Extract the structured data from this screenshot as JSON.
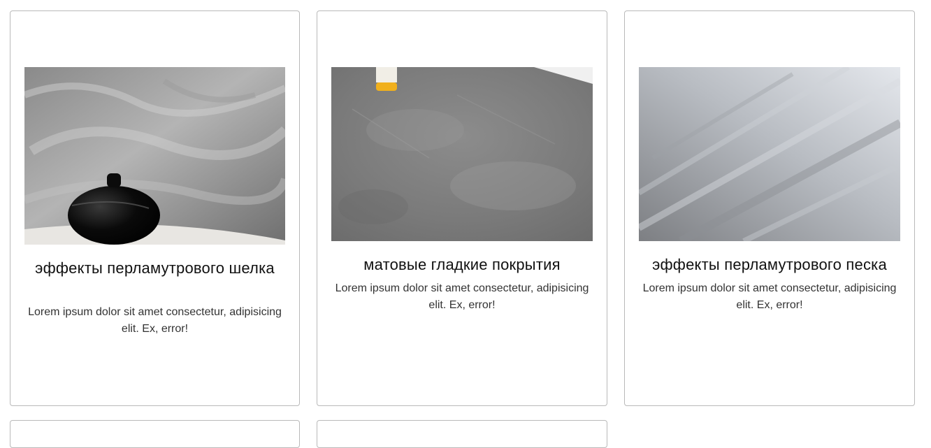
{
  "cards": [
    {
      "title": "эффекты перламутрового шелка",
      "text": "Lorem ipsum dolor sit amet consectetur, adipisicing elit. Ex, error!",
      "image": "pearl-silk-wall-with-black-vase"
    },
    {
      "title": "матовые гладкие покрытия",
      "text": "Lorem ipsum dolor sit amet consectetur, adipisicing elit. Ex, error!",
      "image": "matte-concrete-wall"
    },
    {
      "title": "эффекты перламутрового песка",
      "text": "Lorem ipsum dolor sit amet consectetur, adipisicing elit. Ex, error!",
      "image": "pearl-sand-metallic-wall"
    }
  ],
  "colors": {
    "card_border": "#b9b9b9",
    "title": "#111111",
    "text": "#333333"
  }
}
